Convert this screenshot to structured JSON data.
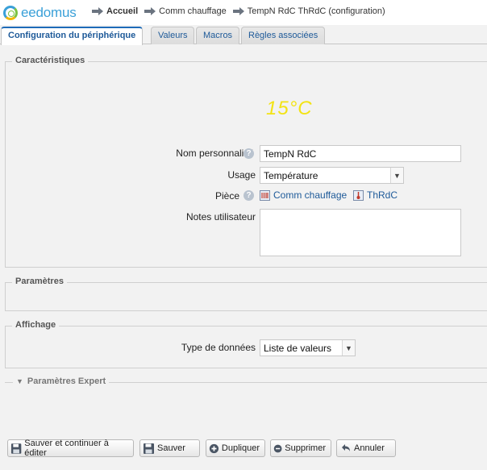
{
  "app": {
    "logo_text": "eedomus"
  },
  "breadcrumb": [
    {
      "label": "Accueil",
      "bold": true
    },
    {
      "label": "Comm chauffage"
    },
    {
      "label": "TempN RdC ThRdC (configuration)"
    }
  ],
  "tabs": [
    {
      "label": "Configuration du périphérique",
      "active": true
    },
    {
      "label": "Valeurs"
    },
    {
      "label": "Macros"
    },
    {
      "label": "Règles associées"
    }
  ],
  "characteristics": {
    "legend": "Caractéristiques",
    "current_value": "15°C",
    "current_value_color": "#f3e314",
    "name_label": "Nom personnalisé",
    "name_value": "TempN RdC",
    "usage_label": "Usage",
    "usage_value": "Température",
    "room_label": "Pièce",
    "room_parent": "Comm chauffage",
    "room_name": "ThRdC",
    "notes_label": "Notes utilisateur",
    "notes_value": ""
  },
  "parameters": {
    "legend": "Paramètres"
  },
  "display": {
    "legend": "Affichage",
    "data_type_label": "Type de données",
    "data_type_value": "Liste de valeurs"
  },
  "expert": {
    "legend": "Paramètres Expert"
  },
  "actions": {
    "save_continue": "Sauver et continuer à éditer",
    "save": "Sauver",
    "duplicate": "Dupliquer",
    "delete": "Supprimer",
    "cancel": "Annuler"
  },
  "colors": {
    "link": "#1e5a99",
    "tab_accent": "#1e6bb8",
    "logo": "#3aa0d8"
  }
}
